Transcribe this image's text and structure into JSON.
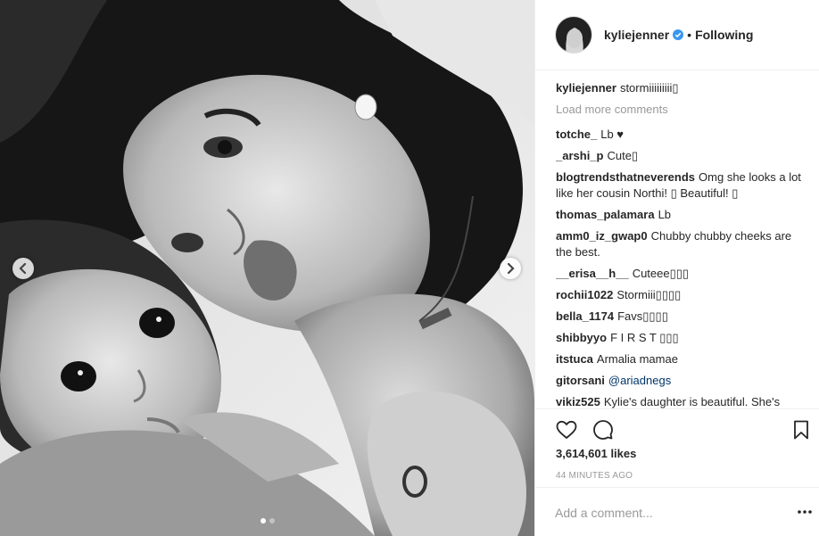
{
  "post": {
    "image_alt": "black and white photo of woman and baby",
    "carousel": {
      "total": 2,
      "current": 1
    }
  },
  "header": {
    "username": "kyliejenner",
    "verified": true,
    "separator": "•",
    "follow_state": "Following"
  },
  "caption": {
    "user": "kyliejenner",
    "text": "stormiiiiiiiii▯"
  },
  "load_more": "Load more comments",
  "comments": [
    {
      "user": "totche_",
      "text": "Lb ♥"
    },
    {
      "user": "_arshi_p",
      "text": "Cute▯"
    },
    {
      "user": "blogtrendsthatneverends",
      "text": "Omg she looks a lot like her cousin Northi! ▯ Beautiful! ▯"
    },
    {
      "user": "thomas_palamara",
      "text": "Lb"
    },
    {
      "user": "amm0_iz_gwap0",
      "text": "Chubby chubby cheeks are the best."
    },
    {
      "user": "__erisa__h__",
      "text": "Cuteee▯▯▯"
    },
    {
      "user": "rochii1022",
      "text": "Stormiii▯▯▯▯"
    },
    {
      "user": "bella_1174",
      "text": "Favs▯▯▯▯"
    },
    {
      "user": "shibbyyo",
      "text": "F I R S T ▯▯▯"
    },
    {
      "user": "itstuca",
      "text": "Armalia mamae"
    },
    {
      "user": "gitorsani",
      "text": "",
      "mention": "@ariadnegs"
    },
    {
      "user": "vikiz525",
      "text": "Kylie's daughter is beautiful. She's"
    }
  ],
  "actions": {
    "like_icon": "heart-icon",
    "comment_icon": "speech-bubble-icon",
    "save_icon": "bookmark-icon"
  },
  "likes": "3,614,601 likes",
  "timestamp": "44 MINUTES AGO",
  "add_comment": {
    "placeholder": "Add a comment...",
    "value": ""
  },
  "more_icon": "ellipsis-icon"
}
